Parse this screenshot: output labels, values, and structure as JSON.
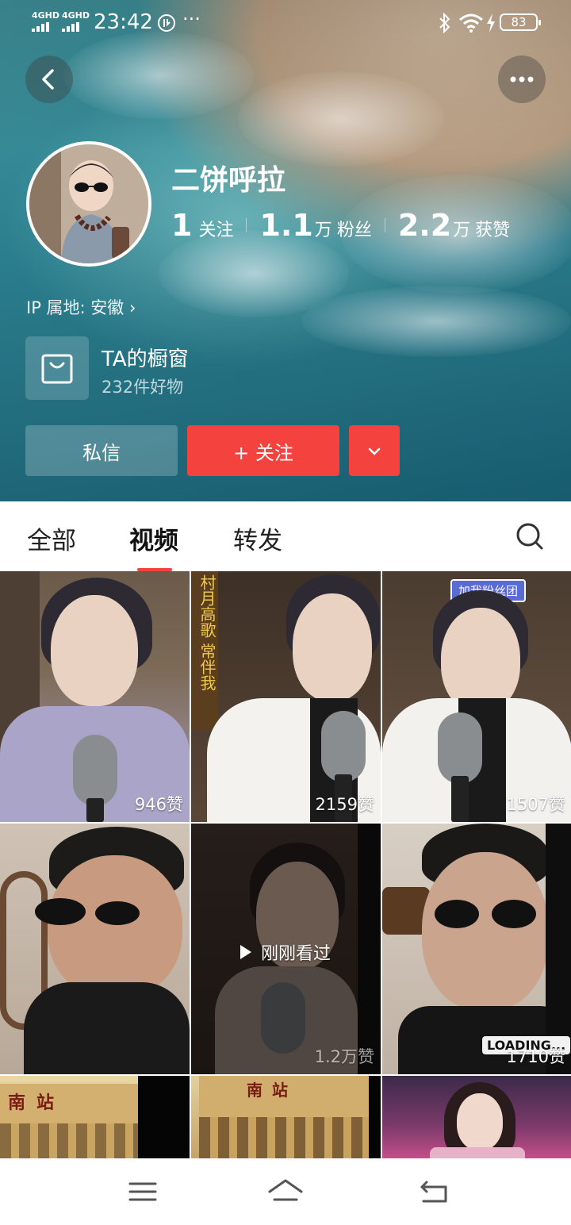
{
  "status_bar": {
    "network_1": "4GHD",
    "network_2": "4GHD",
    "time": "23:42",
    "more": "···",
    "battery": "83"
  },
  "profile": {
    "username": "二饼呼拉",
    "stats": [
      {
        "value": "1",
        "unit": "",
        "label": "关注"
      },
      {
        "value": "1.1",
        "unit": "万",
        "label": "粉丝"
      },
      {
        "value": "2.2",
        "unit": "万",
        "label": "获赞"
      }
    ],
    "ip_location": "IP 属地: 安徽 ›"
  },
  "shop": {
    "title": "TA的橱窗",
    "subtitle": "232件好物"
  },
  "actions": {
    "message_label": "私信",
    "follow_label": "+ 关注"
  },
  "tabs": [
    {
      "label": "全部"
    },
    {
      "label": "视频"
    },
    {
      "label": "转发"
    }
  ],
  "videos": [
    {
      "likes": "946赞",
      "overlay_text": ""
    },
    {
      "likes": "2159赞",
      "overlay_text": "村月高歌 常伴我"
    },
    {
      "likes": "1507赞",
      "overlay_text": "加我粉丝团"
    },
    {
      "likes": "",
      "overlay_text": ""
    },
    {
      "likes": "1.2万赞",
      "overlay_text": "刚刚看过"
    },
    {
      "likes": "1710赞",
      "overlay_text": "LOADING..."
    },
    {
      "likes": "",
      "overlay_text": "南站"
    },
    {
      "likes": "",
      "overlay_text": "南站"
    },
    {
      "likes": "",
      "overlay_text": ""
    }
  ],
  "colors": {
    "accent": "#f4433f",
    "hero_teal": "#2e8594",
    "sand": "#c8b29a"
  },
  "icons": {
    "back": "back-arrow-icon",
    "more": "more-dots-icon",
    "shop": "shopping-bag-icon",
    "dropdown": "chevron-down-icon",
    "search": "search-icon",
    "play": "play-icon",
    "menu": "menu-icon",
    "home": "home-icon",
    "return": "return-icon"
  }
}
